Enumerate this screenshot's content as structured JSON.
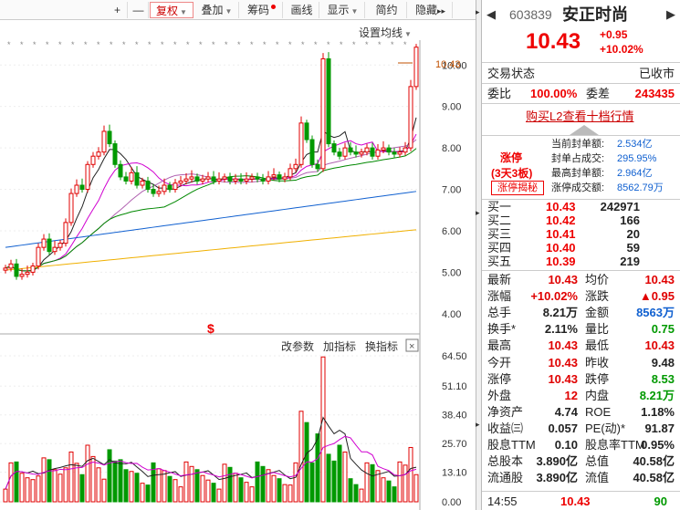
{
  "toolbar": {
    "plus": "+",
    "minus": "—",
    "items": [
      "复权",
      "叠加",
      "筹码",
      "画线",
      "显示",
      "简约",
      "隐藏"
    ],
    "more": "▸▸"
  },
  "chart_labels": {
    "setting": "设置均线",
    "price_tag": "10.43",
    "price_axis": [
      "10.00",
      "9.00",
      "8.00",
      "7.00",
      "6.00",
      "5.00",
      "4.00"
    ],
    "vol_axis": [
      "64.50",
      "51.10",
      "38.40",
      "25.70",
      "13.10",
      "0.00"
    ],
    "vol_toolbar": [
      "改参数",
      "加指标",
      "换指标"
    ],
    "close": "×",
    "dollar_mark": "$"
  },
  "chart_data": {
    "type": "candlestick",
    "price_ylim": [
      3.6,
      10.6
    ],
    "volume_ylim": [
      0,
      64.5
    ],
    "candles_ohlc_approx": "daily bars rising from ~4.9 to 10.43 with limit-up close",
    "last_close": 10.43
  },
  "stock": {
    "code": "603839",
    "name": "安正时尚",
    "price": "10.43",
    "change": "+0.95",
    "pct": "+10.02%",
    "status_label": "交易状态",
    "status_value": "已收市",
    "wb_label": "委比",
    "wb_value": "100.00%",
    "wc_label": "委差",
    "wc_value": "243435",
    "l2_link": "购买L2查看十档行情"
  },
  "limit": {
    "title": "涨停",
    "sub": "(3天3板)",
    "btn": "涨停揭秘",
    "rows": [
      {
        "k": "当前封单额:",
        "v": "2.534亿"
      },
      {
        "k": "封单占成交:",
        "v": "295.95%"
      },
      {
        "k": "最高封单额:",
        "v": "2.964亿"
      },
      {
        "k": "涨停成交额:",
        "v": "8562.79万"
      }
    ]
  },
  "orderbook": [
    {
      "k": "买一",
      "p": "10.43",
      "q": "242971"
    },
    {
      "k": "买二",
      "p": "10.42",
      "q": "166"
    },
    {
      "k": "买三",
      "p": "10.41",
      "q": "20"
    },
    {
      "k": "买四",
      "p": "10.40",
      "q": "59"
    },
    {
      "k": "买五",
      "p": "10.39",
      "q": "219"
    }
  ],
  "quotes": [
    {
      "k": "最新",
      "v": "10.43",
      "c": "red",
      "k2": "均价",
      "v2": "10.43",
      "c2": "red"
    },
    {
      "k": "涨幅",
      "v": "+10.02%",
      "c": "red",
      "k2": "涨跌",
      "v2": "▲0.95",
      "c2": "red"
    },
    {
      "k": "总手",
      "v": "8.21万",
      "c": "",
      "k2": "金额",
      "v2": "8563万",
      "c2": "blu"
    },
    {
      "k": "换手*",
      "v": "2.11%",
      "c": "",
      "k2": "量比",
      "v2": "0.75",
      "c2": "grn"
    },
    {
      "k": "最高",
      "v": "10.43",
      "c": "red",
      "k2": "最低",
      "v2": "10.43",
      "c2": "red"
    },
    {
      "k": "今开",
      "v": "10.43",
      "c": "red",
      "k2": "昨收",
      "v2": "9.48",
      "c2": ""
    },
    {
      "k": "涨停",
      "v": "10.43",
      "c": "red",
      "k2": "跌停",
      "v2": "8.53",
      "c2": "grn"
    },
    {
      "k": "外盘",
      "v": "12",
      "c": "red",
      "k2": "内盘",
      "v2": "8.21万",
      "c2": "grn"
    },
    {
      "k": "净资产",
      "v": "4.74",
      "c": "",
      "k2": "ROE",
      "v2": "1.18%",
      "c2": ""
    },
    {
      "k": "收益㈢",
      "v": "0.057",
      "c": "",
      "k2": "PE(动)*",
      "v2": "91.87",
      "c2": ""
    },
    {
      "k": "股息TTM",
      "v": "0.10",
      "c": "",
      "k2": "股息率TTM",
      "v2": "0.95%",
      "c2": ""
    },
    {
      "k": "总股本",
      "v": "3.890亿",
      "c": "",
      "k2": "总值",
      "v2": "40.58亿",
      "c2": ""
    },
    {
      "k": "流通股",
      "v": "3.890亿",
      "c": "",
      "k2": "流值",
      "v2": "40.58亿",
      "c2": ""
    }
  ],
  "tick": {
    "time": "14:55",
    "price": "10.43",
    "vol": "90"
  },
  "colors": {
    "up": "#e00000",
    "down": "#009900",
    "ma5": "#222222",
    "ma10": "#e0a000",
    "ma20": "#d000d0",
    "ma30": "#008800",
    "ma60": "#1060d0",
    "ma120": "#f0b000"
  }
}
